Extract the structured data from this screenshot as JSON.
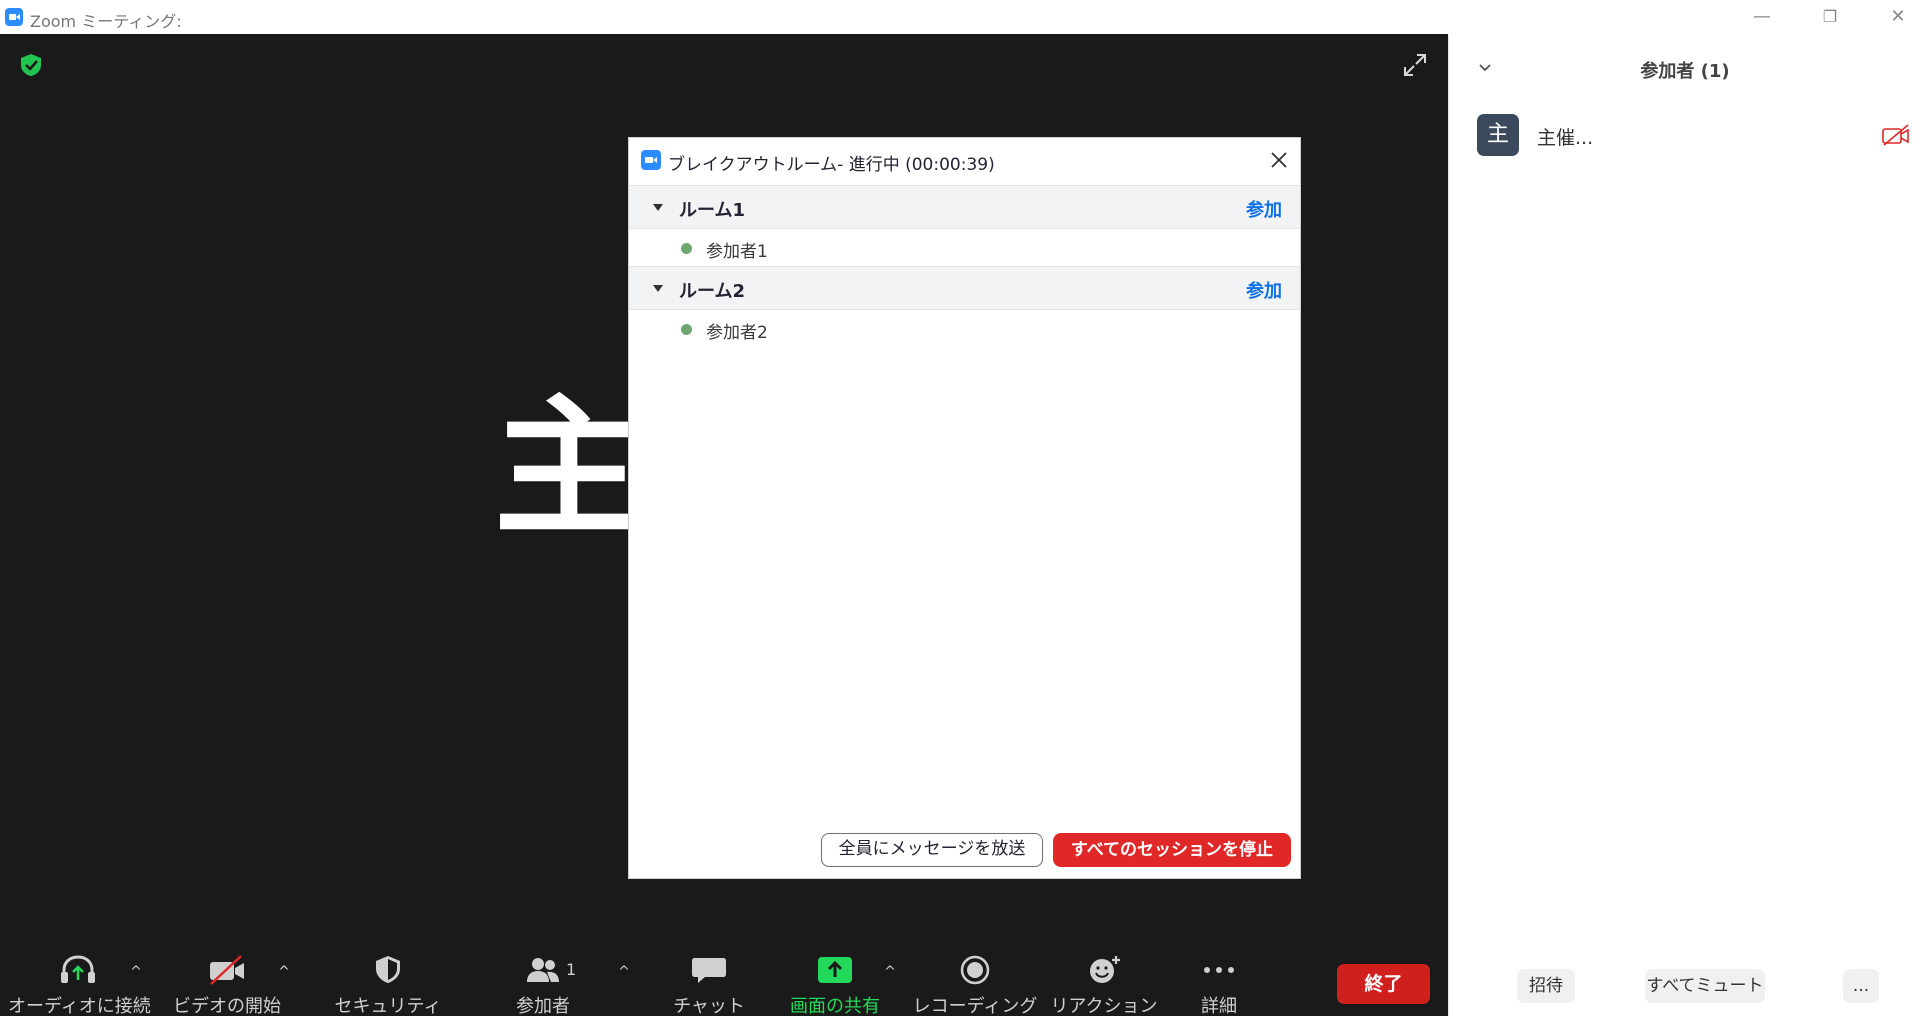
{
  "window": {
    "title": "Zoom ミーティング:",
    "minimize": "—",
    "restore": "❐",
    "close": "✕"
  },
  "stage": {
    "avatar_char": "主"
  },
  "toolbar": {
    "audio": "オーディオに接続",
    "video": "ビデオの開始",
    "security": "セキュリティ",
    "participants": "参加者",
    "participants_count": "1",
    "chat": "チャット",
    "share": "画面の共有",
    "record": "レコーディング",
    "reaction": "リアクション",
    "more": "詳細",
    "end": "終了",
    "caret": "^"
  },
  "dialog": {
    "title": "ブレイクアウトルーム- 進行中 (00:00:39)",
    "rooms": [
      {
        "name": "ルーム1",
        "join": "参加",
        "members": [
          "参加者1"
        ]
      },
      {
        "name": "ルーム2",
        "join": "参加",
        "members": [
          "参加者2"
        ]
      }
    ],
    "broadcast_button": "全員にメッセージを放送",
    "stop_button": "すべてのセッションを停止"
  },
  "panel": {
    "title": "参加者 (1)",
    "participants": [
      {
        "avatar": "主",
        "name": "主催..."
      }
    ],
    "invite": "招待",
    "mute_all": "すべてミュート",
    "more": "..."
  },
  "colors": {
    "accent": "#0e71eb",
    "end_red": "#d0201e",
    "stop_red": "#e02828",
    "share_green": "#23d959",
    "stage_bg": "#1a1a1a"
  }
}
